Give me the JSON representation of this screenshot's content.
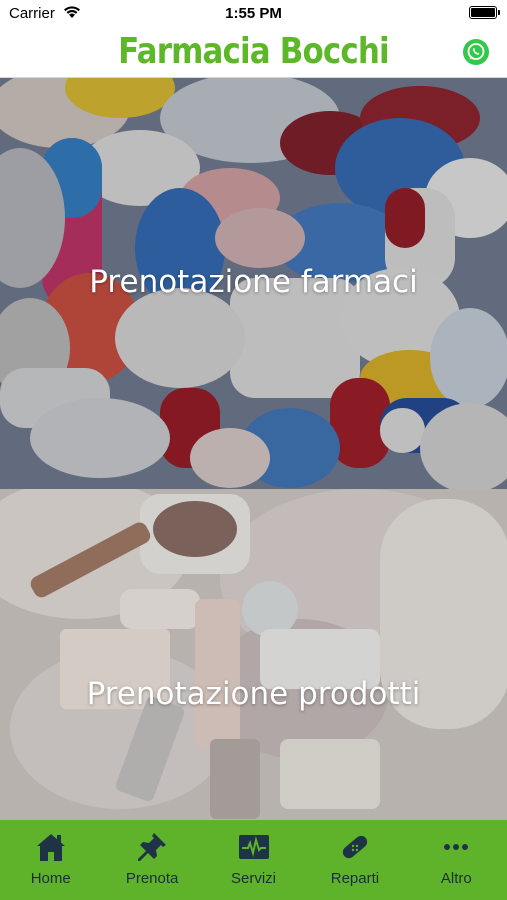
{
  "status_bar": {
    "carrier": "Carrier",
    "time": "1:55 PM"
  },
  "header": {
    "title": "Farmacia Bocchi",
    "title_color": "#5cb829",
    "right_icon": "whatsapp-icon"
  },
  "banners": [
    {
      "label": "Prenotazione farmaci"
    },
    {
      "label": "Prenotazione prodotti"
    }
  ],
  "tab_bar": {
    "background": "#5fb32a",
    "tabs": [
      {
        "label": "Home",
        "icon": "home-icon"
      },
      {
        "label": "Prenota",
        "icon": "pushpin-icon"
      },
      {
        "label": "Servizi",
        "icon": "heartbeat-monitor-icon"
      },
      {
        "label": "Reparti",
        "icon": "bandage-icon"
      },
      {
        "label": "Altro",
        "icon": "more-dots-icon"
      }
    ]
  }
}
